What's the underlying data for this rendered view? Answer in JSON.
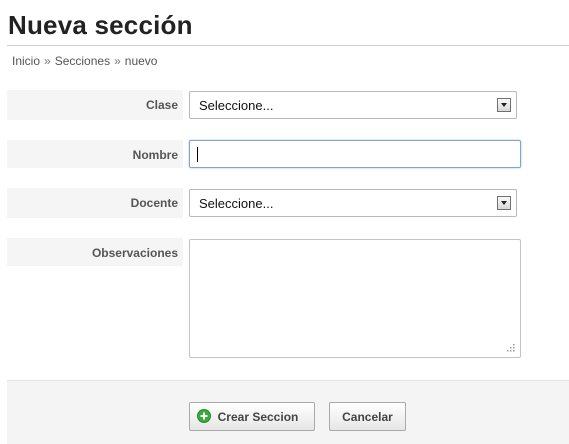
{
  "page": {
    "title": "Nueva sección"
  },
  "breadcrumb": {
    "items": [
      "Inicio",
      "Secciones",
      "nuevo"
    ],
    "separator": "»"
  },
  "form": {
    "clase": {
      "label": "Clase",
      "selected": "Seleccione..."
    },
    "nombre": {
      "label": "Nombre",
      "value": ""
    },
    "docente": {
      "label": "Docente",
      "selected": "Seleccione..."
    },
    "observaciones": {
      "label": "Observaciones",
      "value": ""
    }
  },
  "actions": {
    "create_label": "Crear Seccion",
    "cancel_label": "Cancelar"
  },
  "icons": {
    "create": "plus-circle-icon",
    "select_arrow": "chevron-down-icon",
    "resize": "resize-grip-icon"
  },
  "colors": {
    "create_icon": "#3aa83a",
    "focus_border": "#7fa6c9"
  }
}
